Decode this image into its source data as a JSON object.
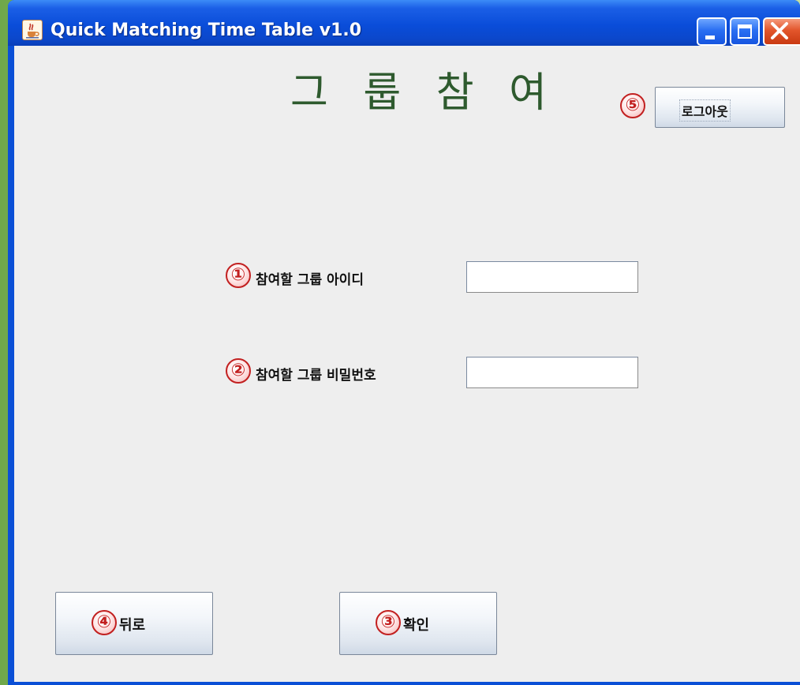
{
  "window": {
    "title": "Quick Matching Time Table v1.0",
    "icon": "java-cup-icon"
  },
  "titlebar_buttons": {
    "minimize": "minimize-icon",
    "maximize": "maximize-icon",
    "close": "close-icon"
  },
  "heading": "그 룹 참 여",
  "logout": {
    "badge": "⑤",
    "label": "로그아웃"
  },
  "form": {
    "group_id": {
      "badge": "①",
      "label": "참여할 그룹 아이디",
      "value": ""
    },
    "group_password": {
      "badge": "②",
      "label": "참여할 그룹 비밀번호",
      "value": ""
    }
  },
  "buttons": {
    "back": {
      "badge": "④",
      "label": "뒤로"
    },
    "confirm": {
      "badge": "③",
      "label": "확인"
    }
  },
  "colors": {
    "heading": "#2e5a2e",
    "badge": "#c22020",
    "titlebar": "#0a4dd9",
    "client_bg": "#eeeeee"
  }
}
